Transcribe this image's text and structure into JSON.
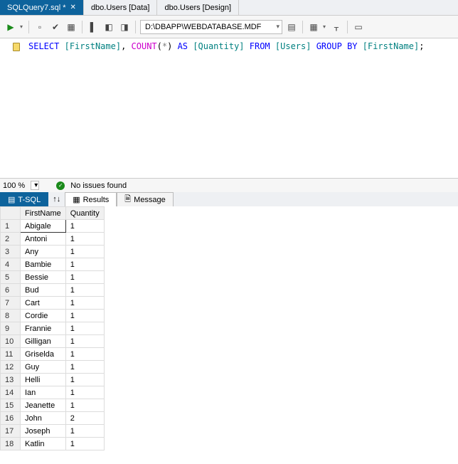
{
  "tabs": [
    {
      "label": "SQLQuery7.sql *",
      "active": true,
      "closable": true
    },
    {
      "label": "dbo.Users [Data]",
      "active": false,
      "closable": false
    },
    {
      "label": "dbo.Users [Design]",
      "active": false,
      "closable": false
    }
  ],
  "toolbar": {
    "dbpath": "D:\\DBAPP\\WEBDATABASE.MDF"
  },
  "sql": {
    "tokens": [
      {
        "t": "SELECT",
        "c": "kw"
      },
      {
        "t": " "
      },
      {
        "t": "[FirstName]",
        "c": "id"
      },
      {
        "t": ", "
      },
      {
        "t": "COUNT",
        "c": "fn"
      },
      {
        "t": "("
      },
      {
        "t": "*",
        "c": "op"
      },
      {
        "t": ") "
      },
      {
        "t": "AS",
        "c": "kw"
      },
      {
        "t": " "
      },
      {
        "t": "[Quantity]",
        "c": "id"
      },
      {
        "t": " "
      },
      {
        "t": "FROM",
        "c": "kw"
      },
      {
        "t": " "
      },
      {
        "t": "[Users]",
        "c": "id"
      },
      {
        "t": " "
      },
      {
        "t": "GROUP",
        "c": "kw"
      },
      {
        "t": " "
      },
      {
        "t": "BY",
        "c": "kw"
      },
      {
        "t": " "
      },
      {
        "t": "[FirstName]",
        "c": "id"
      },
      {
        "t": ";"
      }
    ]
  },
  "status": {
    "zoom": "100 %",
    "issues_text": "No issues found"
  },
  "result_tabs": {
    "tsql": "T-SQL",
    "results": "Results",
    "message": "Message"
  },
  "grid": {
    "columns": [
      "FirstName",
      "Quantity"
    ],
    "rows": [
      {
        "n": "1",
        "FirstName": "Abigale",
        "Quantity": "1"
      },
      {
        "n": "2",
        "FirstName": "Antoni",
        "Quantity": "1"
      },
      {
        "n": "3",
        "FirstName": "Any",
        "Quantity": "1"
      },
      {
        "n": "4",
        "FirstName": "Bambie",
        "Quantity": "1"
      },
      {
        "n": "5",
        "FirstName": "Bessie",
        "Quantity": "1"
      },
      {
        "n": "6",
        "FirstName": "Bud",
        "Quantity": "1"
      },
      {
        "n": "7",
        "FirstName": "Cart",
        "Quantity": "1"
      },
      {
        "n": "8",
        "FirstName": "Cordie",
        "Quantity": "1"
      },
      {
        "n": "9",
        "FirstName": "Frannie",
        "Quantity": "1"
      },
      {
        "n": "10",
        "FirstName": "Gilligan",
        "Quantity": "1"
      },
      {
        "n": "11",
        "FirstName": "Griselda",
        "Quantity": "1"
      },
      {
        "n": "12",
        "FirstName": "Guy",
        "Quantity": "1"
      },
      {
        "n": "13",
        "FirstName": "Helli",
        "Quantity": "1"
      },
      {
        "n": "14",
        "FirstName": "Ian",
        "Quantity": "1"
      },
      {
        "n": "15",
        "FirstName": "Jeanette",
        "Quantity": "1"
      },
      {
        "n": "16",
        "FirstName": "John",
        "Quantity": "2"
      },
      {
        "n": "17",
        "FirstName": "Joseph",
        "Quantity": "1"
      },
      {
        "n": "18",
        "FirstName": "Katlin",
        "Quantity": "1"
      }
    ]
  }
}
